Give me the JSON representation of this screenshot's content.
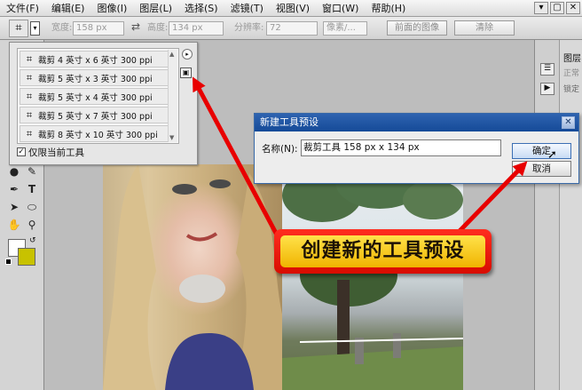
{
  "menubar": {
    "items": [
      "文件(F)",
      "编辑(E)",
      "图像(I)",
      "图层(L)",
      "选择(S)",
      "滤镜(T)",
      "视图(V)",
      "窗口(W)",
      "帮助(H)"
    ],
    "window_controls": [
      "▾",
      "▢",
      "✕"
    ]
  },
  "options_bar": {
    "width_label": "宽度:",
    "width_value": "158 px",
    "swap_icon": "⇄",
    "height_label": "高度:",
    "height_value": "134 px",
    "resolution_label": "分辨率:",
    "resolution_value": "72",
    "unit_value": "像素/...",
    "front_image_button": "前面的图像",
    "clear_button": "清除"
  },
  "preset_panel": {
    "presets": [
      "裁剪 4 英寸 x 6 英寸 300 ppi",
      "裁剪 5 英寸 x 3 英寸 300 ppi",
      "裁剪 5 英寸 x 4 英寸 300 ppi",
      "裁剪 5 英寸 x 7 英寸 300 ppi",
      "裁剪 8 英寸 x 10 英寸 300 ppi"
    ],
    "current_tool_only_label": "仅限当前工具",
    "current_tool_only_checked": true
  },
  "dialog": {
    "title": "新建工具预设",
    "name_label": "名称(N):",
    "name_value": "裁剪工具 158 px x 134 px",
    "ok_button": "确定",
    "cancel_button": "取消",
    "close_glyph": "✕"
  },
  "right_panel": {
    "layers_tab": "图层",
    "blend_mode": "正常",
    "lock_label": "锁定"
  },
  "callout": {
    "text": "创建新的工具预设"
  },
  "colors": {
    "callout_border": "#e01000",
    "callout_fill": "#f7c81e",
    "dialog_title": "#1f57a4",
    "arrow": "#e80000"
  }
}
